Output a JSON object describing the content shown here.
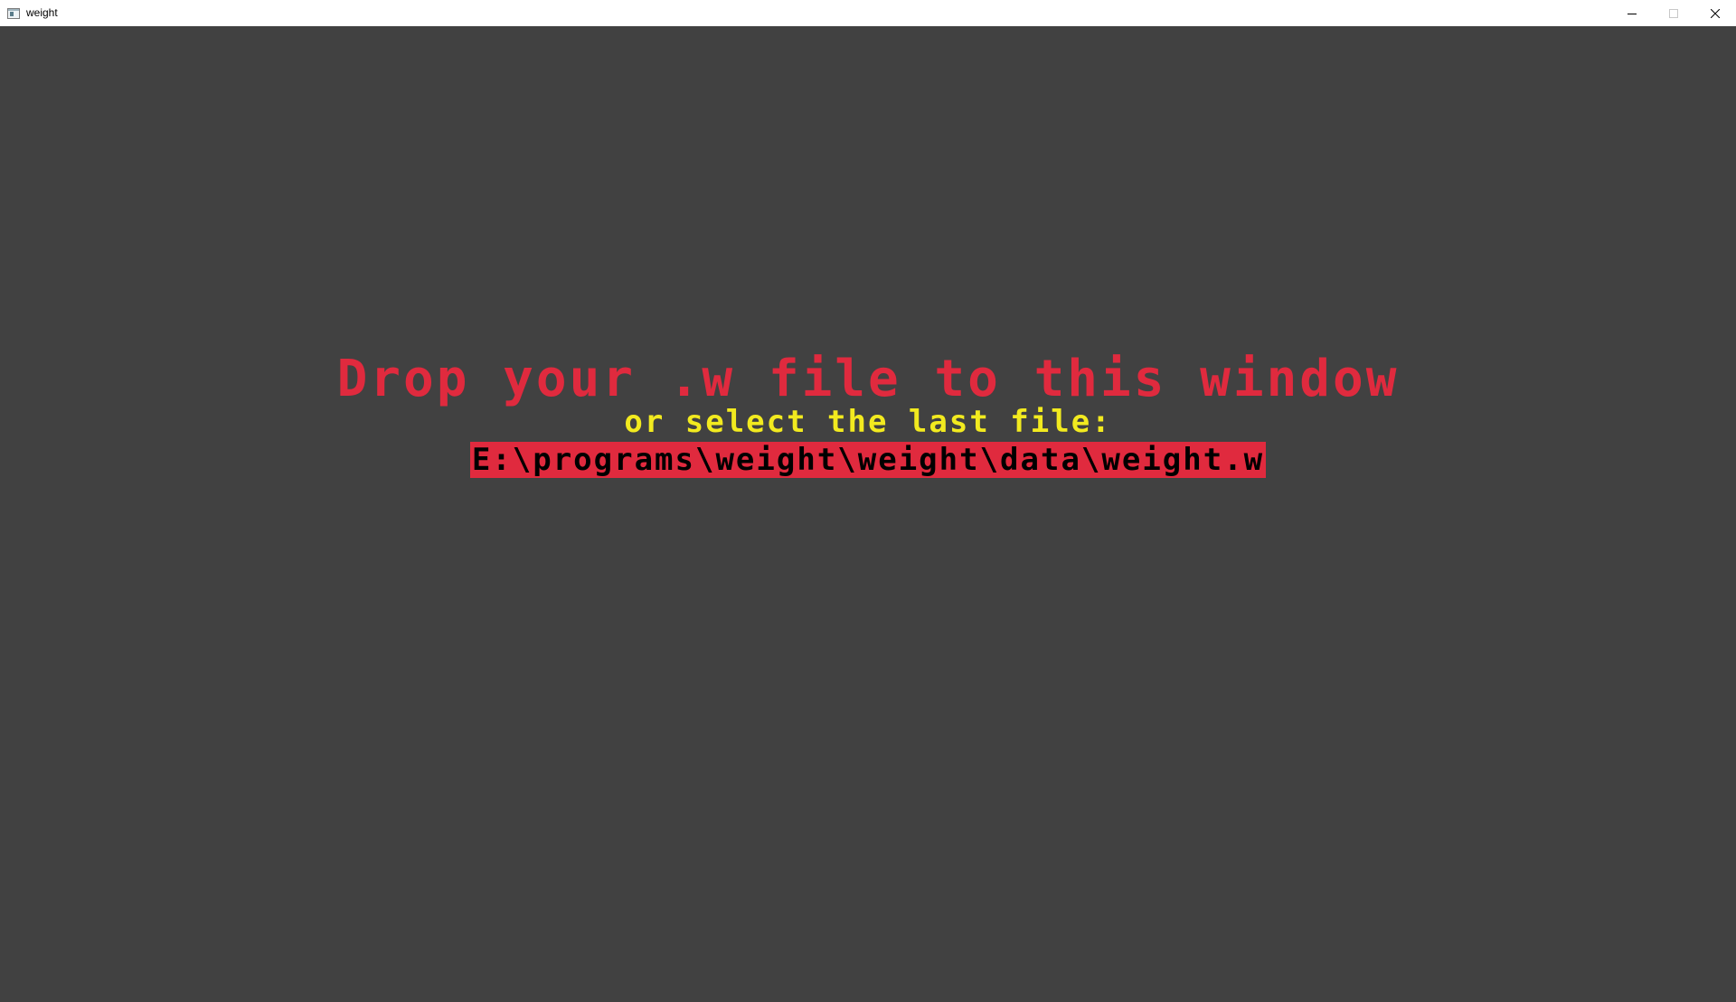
{
  "window": {
    "title": "weight",
    "controls": {
      "minimize_icon": "minimize-icon",
      "maximize_icon": "maximize-icon",
      "close_icon": "close-icon"
    }
  },
  "main": {
    "drop_message": "Drop your .w file to this window",
    "select_message": "or select the last file:",
    "last_file_path": "E:\\programs\\weight\\weight\\data\\weight.w"
  },
  "colors": {
    "background": "#414141",
    "accent_red": "#e02a3e",
    "accent_yellow": "#f2ea1f",
    "path_text": "#000000"
  }
}
